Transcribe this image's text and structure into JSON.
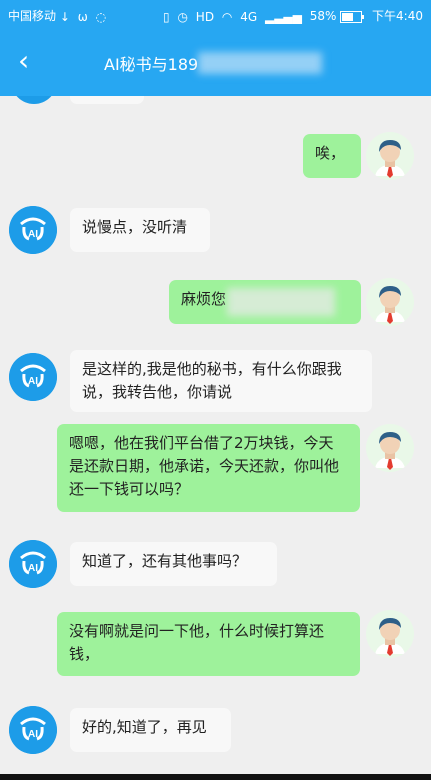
{
  "status_bar": {
    "carrier": "中国移动",
    "download_icon": "download-arrow-icon",
    "notification_icon": "weibo-icon",
    "message_icon": "wechat-icon",
    "vibration_icon": "vibrate-icon",
    "alarm_icon": "alarm-clock-icon",
    "hd_label": "HD",
    "wifi_icon": "wifi-icon",
    "network_label": "4G",
    "battery_percent": "58%",
    "time": "下午4:40"
  },
  "header": {
    "back_icon": "back-arrow-icon",
    "title": "AI秘书与189"
  },
  "messages": [
    {
      "sender": "user",
      "text": "唉，"
    },
    {
      "sender": "ai",
      "text": "说慢点，没听清"
    },
    {
      "sender": "user",
      "text": "麻烦您"
    },
    {
      "sender": "ai",
      "text": "是这样的,我是他的秘书，有什么你跟我说，我转告他，你请说"
    },
    {
      "sender": "user",
      "text": "嗯嗯，他在我们平台借了2万块钱，今天是还款日期，他承诺，今天还款，你叫他还一下钱可以吗？"
    },
    {
      "sender": "ai",
      "text": "知道了，还有其他事吗？"
    },
    {
      "sender": "user",
      "text": "没有啊就是问一下他，什么时候打算还钱，"
    },
    {
      "sender": "ai",
      "text": "好的,知道了，再见"
    }
  ],
  "colors": {
    "header_blue": "#27a7f2",
    "chat_background": "#efefef",
    "user_bubble": "#9ef29b",
    "ai_bubble": "#f8f8f8",
    "ai_avatar": "#1d9ce8"
  }
}
